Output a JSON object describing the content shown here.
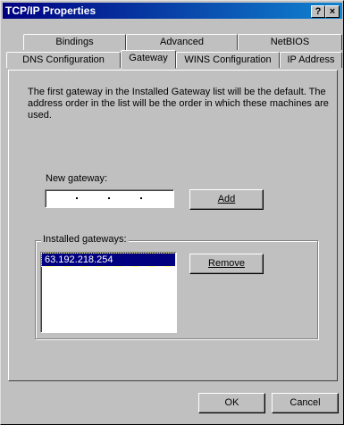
{
  "window": {
    "title": "TCP/IP Properties",
    "help_glyph": "?",
    "close_glyph": "×"
  },
  "tabs": {
    "row_back": [
      "Bindings",
      "Advanced",
      "NetBIOS"
    ],
    "row_front": [
      "DNS Configuration",
      "Gateway",
      "WINS Configuration",
      "IP Address"
    ],
    "active": "Gateway"
  },
  "gateway": {
    "description": "The first gateway in the Installed Gateway list will be the default. The address order in the list will be the order in which these machines are used.",
    "new_gateway_label": "New gateway:",
    "new_gateway_value": "",
    "add_button": "Add",
    "installed_label": "Installed gateways:",
    "installed_list": [
      "63.192.218.254"
    ],
    "remove_button": "Remove"
  },
  "footer": {
    "ok_button": "OK",
    "cancel_button": "Cancel"
  }
}
